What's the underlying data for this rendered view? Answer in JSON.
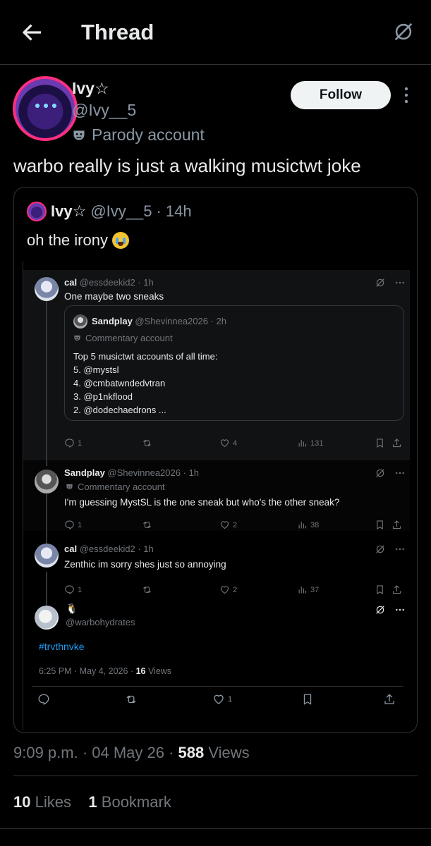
{
  "header": {
    "title": "Thread"
  },
  "author": {
    "display_name": "Ivy☆",
    "handle": "@Ivy__5",
    "label": "Parody account",
    "follow_label": "Follow"
  },
  "tweet": {
    "text": "warbo really is just a walking musictwt joke"
  },
  "quoted": {
    "display_name": "Ivy☆",
    "handle": "@Ivy__5",
    "time": "· 14h",
    "text": "oh the irony"
  },
  "screenshot": {
    "reply1": {
      "name": "cal",
      "handle": "@essdeekid2",
      "time": "· 1h",
      "text": "One maybe two sneaks",
      "inner": {
        "name": "Sandplay",
        "handle": "@Shevinnea2026",
        "time": "· 2h",
        "label": "Commentary account",
        "lines": [
          "Top 5 musictwt accounts of all time:",
          "5. @mystsl",
          "4. @cmbatwndedvtran",
          "3. @p1nkflood",
          "2. @dodechaedrons ..."
        ]
      },
      "replies": "1",
      "likes": "4",
      "views": "131"
    },
    "reply2": {
      "name": "Sandplay",
      "handle": "@Shevinnea2026",
      "time": "· 1h",
      "label": "Commentary account",
      "text": "I'm guessing MystSL is the one sneak but who's the other sneak?",
      "replies": "1",
      "likes": "2",
      "views": "38"
    },
    "reply3": {
      "name": "cal",
      "handle": "@essdeekid2",
      "time": "· 1h",
      "text": "Zenthic im sorry shes just so annoying",
      "replies": "1",
      "likes": "2",
      "views": "37"
    },
    "main": {
      "name": "🐧",
      "handle": "@warbohydrates",
      "hashtag": "#trvthnvke",
      "timestamp": "6:25 PM · May 4, 2026 · ",
      "views_count": "16",
      "views_label": " Views",
      "likes": "1"
    }
  },
  "meta": {
    "time": "9:09 p.m. · 04 May 26 · ",
    "views_count": "588",
    "views_label": " Views"
  },
  "stats": {
    "likes_count": "10",
    "likes_label": " Likes",
    "bookmarks_count": "1",
    "bookmarks_label": " Bookmark"
  },
  "colors": {
    "background": "#000000",
    "link": "#1d9bf0",
    "avatar_ring": "#ff2e7e"
  }
}
